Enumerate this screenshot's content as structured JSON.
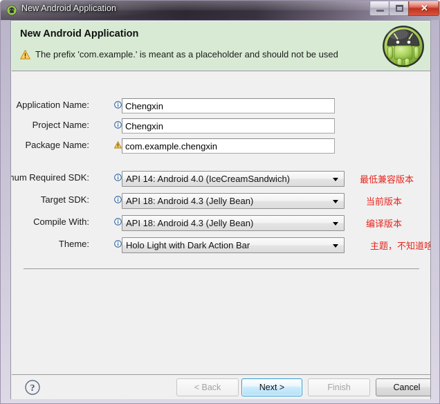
{
  "window": {
    "title": "New Android Application",
    "icon": "android-icon",
    "controls": {
      "minimize": "minimize-button",
      "maximize": "maximize-button",
      "close_glyph": "✕"
    }
  },
  "header": {
    "title": "New Android Application",
    "message": "The prefix 'com.example.' is meant as a placeholder and should not be used",
    "message_icon": "warning-icon",
    "logo": "android-robot-logo",
    "bg_color": "#d8ead4"
  },
  "form": {
    "text_fields": [
      {
        "label": "Application Name:",
        "icon": "info-icon",
        "value": "Chengxin",
        "placeholder": ""
      },
      {
        "label": "Project Name:",
        "icon": "info-icon",
        "value": "Chengxin",
        "placeholder": ""
      },
      {
        "label": "Package Name:",
        "icon": "warning-icon",
        "value": "com.example.chengxin",
        "placeholder": ""
      }
    ],
    "combos": [
      {
        "label": "Minimum Required SDK:",
        "icon": "info-icon",
        "value": "API 14: Android 4.0 (IceCreamSandwich)",
        "note": "最低兼容版本"
      },
      {
        "label": "Target SDK:",
        "icon": "info-icon",
        "value": "API 18: Android 4.3 (Jelly Bean)",
        "note": "当前版本"
      },
      {
        "label": "Compile With:",
        "icon": "info-icon",
        "value": "API 18: Android 4.3 (Jelly Bean)",
        "note": "编译版本"
      },
      {
        "label": "Theme:",
        "icon": "info-icon",
        "value": "Holo Light with Dark Action Bar",
        "note": "主题，不知道啥意思"
      }
    ],
    "note_color": "#e8241c"
  },
  "footer": {
    "help_icon": "help-question-icon",
    "buttons": [
      {
        "label": "< Back",
        "state": "disabled"
      },
      {
        "label": "Next >",
        "state": "default"
      },
      {
        "label": "Finish",
        "state": "disabled"
      },
      {
        "label": "Cancel",
        "state": "normal"
      }
    ]
  }
}
